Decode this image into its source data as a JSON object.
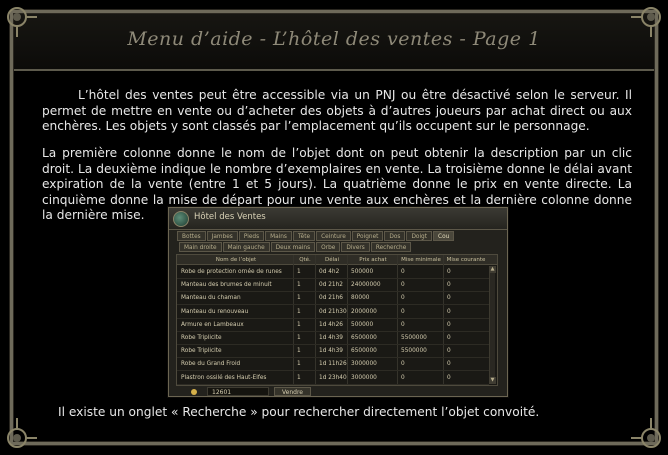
{
  "header": {
    "title": "Menu d’aide - L’hôtel des ventes - Page 1"
  },
  "content": {
    "paragraph1": "L’hôtel des ventes peut être accessible via un PNJ ou être désactivé selon le serveur. Il permet de mettre en vente ou d’acheter des objets à d’autres joueurs par achat direct ou aux enchères. Les objets y sont classés par l’emplacement qu’ils occupent sur le personnage.",
    "paragraph2": "La première colonne donne le nom de l’objet dont on peut obtenir la description par un clic droit. La deuxième indique le nombre d’exemplaires en vente. La troisième donne le délai avant expiration de la vente (entre 1 et 5 jours). La quatrième donne le prix en vente directe. La cinquième donne la mise de départ pour une vente aux enchères et la dernière colonne donne la dernière mise.",
    "footer": "Il existe un onglet « Recherche » pour rechercher directement l’objet convoité."
  },
  "auction_window": {
    "title": "Hôtel des Ventes",
    "tabs_row1": [
      "Bottes",
      "Jambes",
      "Pieds",
      "Mains",
      "Tête",
      "Ceinture",
      "Poignet",
      "Dos",
      "Doigt",
      "Cou"
    ],
    "tabs_row2": [
      "Main droite",
      "Main gauche",
      "Deux mains",
      "Orbe",
      "Divers",
      "Recherche"
    ],
    "columns": [
      "Nom de l’objet",
      "Qté.",
      "Délai",
      "Prix achat",
      "Mise minimale",
      "Mise courante"
    ],
    "rows": [
      [
        "Robe de protection ornée de runes",
        "1",
        "0d 4h2",
        "500000",
        "0",
        "0"
      ],
      [
        "Manteau des brumes de minuit",
        "1",
        "0d 21h2",
        "24000000",
        "0",
        "0"
      ],
      [
        "Manteau du chaman",
        "1",
        "0d 21h6",
        "80000",
        "0",
        "0"
      ],
      [
        "Manteau du renouveau",
        "1",
        "0d 21h30",
        "2000000",
        "0",
        "0"
      ],
      [
        "Armure en Lambeaux",
        "1",
        "1d 4h26",
        "500000",
        "0",
        "0"
      ],
      [
        "Robe Triplicite",
        "1",
        "1d 4h39",
        "6500000",
        "5500000",
        "0"
      ],
      [
        "Robe Triplicite",
        "1",
        "1d 4h39",
        "6500000",
        "5500000",
        "0"
      ],
      [
        "Robe du Grand Froid",
        "1",
        "1d 11h26",
        "3000000",
        "0",
        "0"
      ],
      [
        "Plastron ossilé des Haut-Elfes",
        "1",
        "1d 23h40",
        "3000000",
        "0",
        "0"
      ]
    ],
    "money": "12601",
    "sell_label": "Vendre",
    "scroll_up": "▲",
    "scroll_down": "▼"
  },
  "colors": {
    "background": "#000000",
    "border": "#6e6a5a",
    "title": "#8e8978",
    "text": "#e8e8e8"
  }
}
